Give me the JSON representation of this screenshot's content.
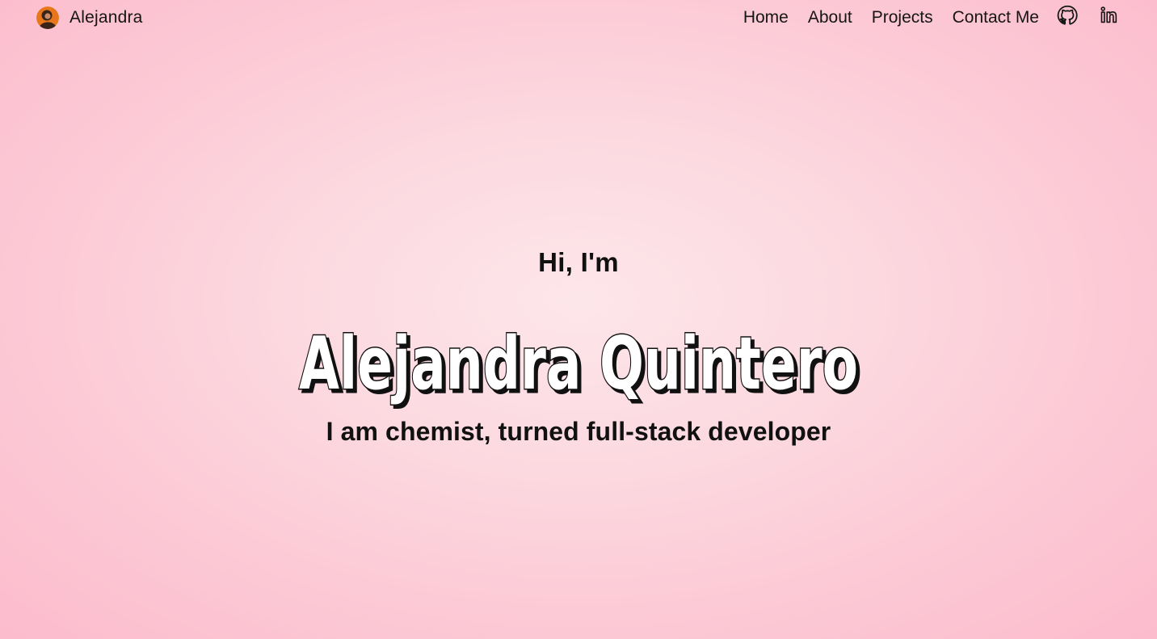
{
  "navbar": {
    "brand_name": "Alejandra",
    "links": [
      {
        "label": "Home"
      },
      {
        "label": "About"
      },
      {
        "label": "Projects"
      },
      {
        "label": "Contact Me"
      }
    ],
    "social": [
      {
        "icon": "github-icon"
      },
      {
        "icon": "linkedin-icon"
      }
    ]
  },
  "hero": {
    "greeting": "Hi, I'm",
    "name": "Alejandra Quintero",
    "tagline": "I am chemist, turned full-stack developer"
  },
  "colors": {
    "background_center": "#fde6ea",
    "background_edge": "#fcbccd",
    "text": "#111111",
    "name_fill": "#ffffff",
    "name_outline": "#111111",
    "avatar": "#e8771b"
  }
}
